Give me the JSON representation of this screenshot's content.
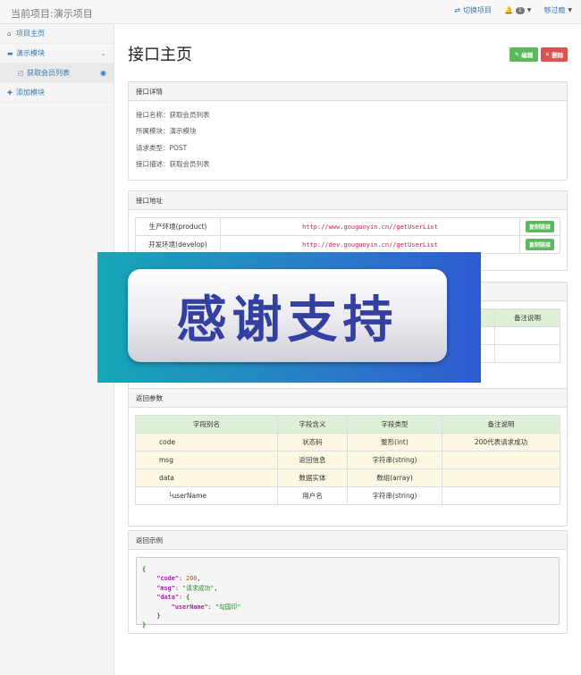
{
  "navbar": {
    "brand": "当前项目:演示项目",
    "switch_project": "切换项目",
    "notify_count": "1",
    "user": "够过瘾"
  },
  "sidebar": {
    "items": [
      {
        "label": "项目主页",
        "icon": "home-icon"
      },
      {
        "label": "演示模块",
        "icon": "folder-icon"
      },
      {
        "label": "获取会员列表",
        "icon": "api-icon"
      },
      {
        "label": "添加模块",
        "icon": "plus-icon"
      }
    ]
  },
  "main": {
    "title": "接口主页",
    "edit_label": "编辑",
    "delete_label": "删除"
  },
  "detail": {
    "heading": "接口详情",
    "rows": [
      "接口名称：获取会员列表",
      "所属模块：演示模块",
      "请求类型：POST",
      "接口描述：获取会员列表"
    ]
  },
  "address": {
    "heading": "接口地址",
    "rows": [
      {
        "env": "生产环境(product)",
        "url": "http://www.gouguoyin.cn//getUserList",
        "copy": "复制链接"
      },
      {
        "env": "开发环境(develop)",
        "url": "http://dev.gouguoyin.cn//getUserList",
        "copy": "复制链接"
      }
    ]
  },
  "request": {
    "col_remark": "备注说明"
  },
  "response": {
    "heading": "返回参数",
    "headers": [
      "字段别名",
      "字段含义",
      "字段类型",
      "备注说明"
    ],
    "rows": [
      {
        "name": "code",
        "meaning": "状态码",
        "type": "整形(int)",
        "remark": "200代表请求成功"
      },
      {
        "name": "msg",
        "meaning": "返回信息",
        "type": "字符串(string)",
        "remark": ""
      },
      {
        "name": "data",
        "meaning": "数据实体",
        "type": "数组(array)",
        "remark": ""
      },
      {
        "name": "└userName",
        "meaning": "用户名",
        "type": "字符串(string)",
        "remark": ""
      }
    ]
  },
  "example": {
    "heading": "返回示例",
    "open": "{",
    "code_key": "\"code\"",
    "code_val": "200",
    "msg_key": "\"msg\"",
    "msg_val": "\"请求成功\"",
    "data_key": "\"data\"",
    "user_key": "\"userName\"",
    "user_val": "\"勾国印\"",
    "inner_close": "}",
    "close": "}"
  },
  "overlay": {
    "text": "感谢支持"
  },
  "colors": {
    "link": "#337ab7",
    "success": "#5cb85c",
    "danger": "#d9534f",
    "header_green": "#dff0d8",
    "row_warning": "#fcf8e3"
  }
}
